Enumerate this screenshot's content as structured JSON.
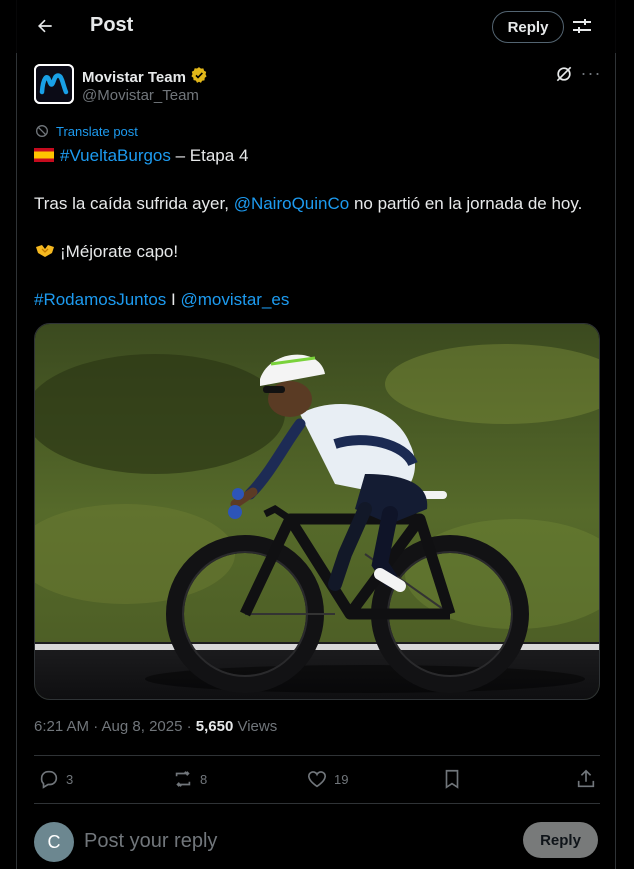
{
  "header": {
    "title": "Post",
    "reply_label": "Reply"
  },
  "author": {
    "name": "Movistar Team",
    "handle": "@Movistar_Team"
  },
  "translate_label": "Translate post",
  "tweet": {
    "line1_tag": "#VueltaBurgos",
    "line1_rest": " – Etapa 4",
    "line2_pre": "Tras la caída sufrida ayer, ",
    "line2_mention": "@NairoQuinCo",
    "line2_post": " no partió en la jornada de hoy.",
    "line3": "¡Méjorate capo!",
    "line4_tag": "#RodamosJuntos",
    "line4_sep": " I ",
    "line4_mention": "@movistar_es"
  },
  "meta": {
    "time": "6:21 AM · Aug 8, 2025 · ",
    "views_count": "5,650",
    "views_label": " Views"
  },
  "actions": {
    "replies": "3",
    "reposts": "8",
    "likes": "19"
  },
  "composer": {
    "avatar_letter": "C",
    "placeholder": "Post your reply",
    "reply_label": "Reply"
  },
  "colors": {
    "accent": "#1d9bf0",
    "verified": "#e2b719",
    "background": "#000000"
  }
}
